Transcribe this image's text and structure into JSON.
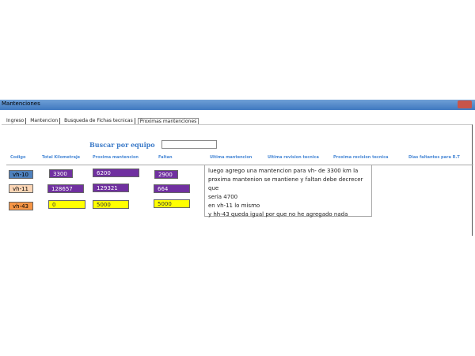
{
  "window": {
    "title": "Mantenciones"
  },
  "tabs": [
    "Ingreso",
    "Mantencion",
    "Busqueda de Fichas tecnicas",
    "Proximas mantenciones"
  ],
  "search": {
    "label": "Buscar por equipo",
    "value": ""
  },
  "headers": [
    "Codigo",
    "Total Kilometraje",
    "Proxima mantencion",
    "Faltan",
    "Ultima mantencion",
    "Ultima revision tecnica",
    "Proxima revision tecnica",
    "Dias faltantes para R.T"
  ],
  "rows": [
    {
      "code": "vh-10",
      "km": "3300",
      "next": "6200",
      "left": "2900",
      "code_color": "#4f81bd"
    },
    {
      "code": "vh-11",
      "km": "128657",
      "next": "129321",
      "left": "664",
      "code_color": "#fbd5b5"
    },
    {
      "code": "vh-43",
      "km": "0",
      "next": "5000",
      "left": "5000",
      "code_color": "#f79646"
    }
  ],
  "note": [
    "luego agrego una mantencion para vh- de 3300  km la",
    "proxima mantenion se mantiene y faltan debe decrecer que",
    "seria 4700",
    "en vh-11 lo mismo",
    "y hh-43 queda igual por que no he agregado nada"
  ]
}
